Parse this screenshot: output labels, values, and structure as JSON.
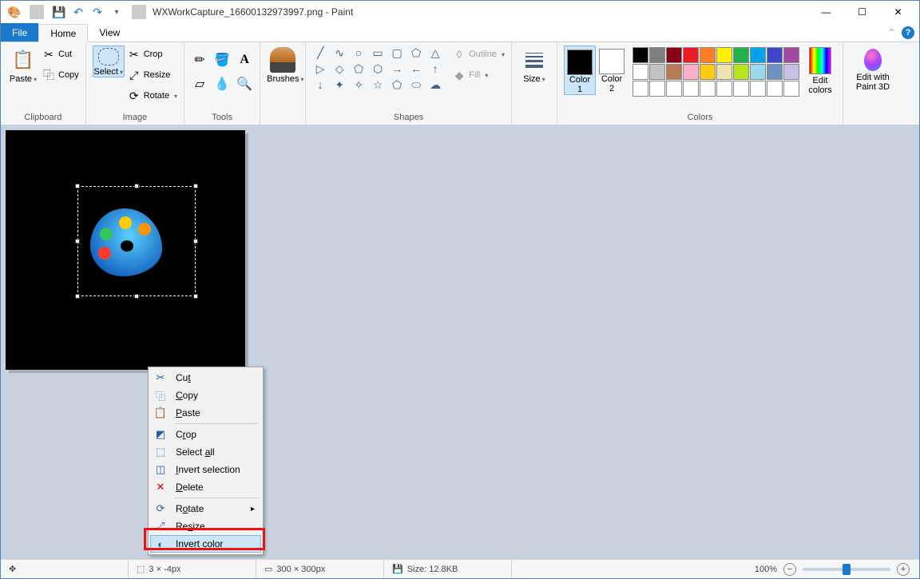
{
  "titlebar": {
    "filename": "WXWorkCapture_16600132973997.png - Paint"
  },
  "tabs": {
    "file": "File",
    "home": "Home",
    "view": "View"
  },
  "ribbon": {
    "clipboard": {
      "paste": "Paste",
      "cut": "Cut",
      "copy": "Copy",
      "label": "Clipboard"
    },
    "image": {
      "select": "Select",
      "crop": "Crop",
      "resize": "Resize",
      "rotate": "Rotate",
      "label": "Image"
    },
    "tools": {
      "label": "Tools"
    },
    "brushes": {
      "brushes": "Brushes"
    },
    "shapes": {
      "outline": "Outline",
      "fill": "Fill",
      "label": "Shapes"
    },
    "size": {
      "size": "Size"
    },
    "colors": {
      "c1": "Color\n1",
      "c2": "Color\n2",
      "edit": "Edit\ncolors",
      "label": "Colors"
    },
    "paint3d": {
      "label": "Edit with\nPaint 3D"
    }
  },
  "palette": [
    "#000000",
    "#7f7f7f",
    "#880015",
    "#ed1c24",
    "#ff7f27",
    "#fff200",
    "#22b14c",
    "#00a2e8",
    "#3f48cc",
    "#a349a4",
    "#ffffff",
    "#c3c3c3",
    "#b97a57",
    "#ffaec9",
    "#ffc90e",
    "#efe4b0",
    "#b5e61d",
    "#99d9ea",
    "#7092be",
    "#c8bfe7",
    "#ffffff",
    "#ffffff",
    "#ffffff",
    "#ffffff",
    "#ffffff",
    "#ffffff",
    "#ffffff",
    "#ffffff",
    "#ffffff",
    "#ffffff"
  ],
  "context_menu": {
    "cut": "Cut",
    "copy": "Copy",
    "paste": "Paste",
    "crop": "Crop",
    "select_all": "Select all",
    "invert_sel": "Invert selection",
    "delete": "Delete",
    "rotate": "Rotate",
    "resize": "Resize",
    "invert_color": "Invert color",
    "keys": {
      "cut": "t",
      "copy": "C",
      "paste": "P",
      "crop": "C",
      "select_all": "A",
      "invert_sel": "I",
      "delete": "D",
      "rotate": "R",
      "resize": "s",
      "invert_color": "v"
    }
  },
  "status": {
    "cursor": "3 × -4px",
    "canvas": "300 × 300px",
    "filesize": "Size: 12.8KB",
    "zoom": "100%"
  }
}
